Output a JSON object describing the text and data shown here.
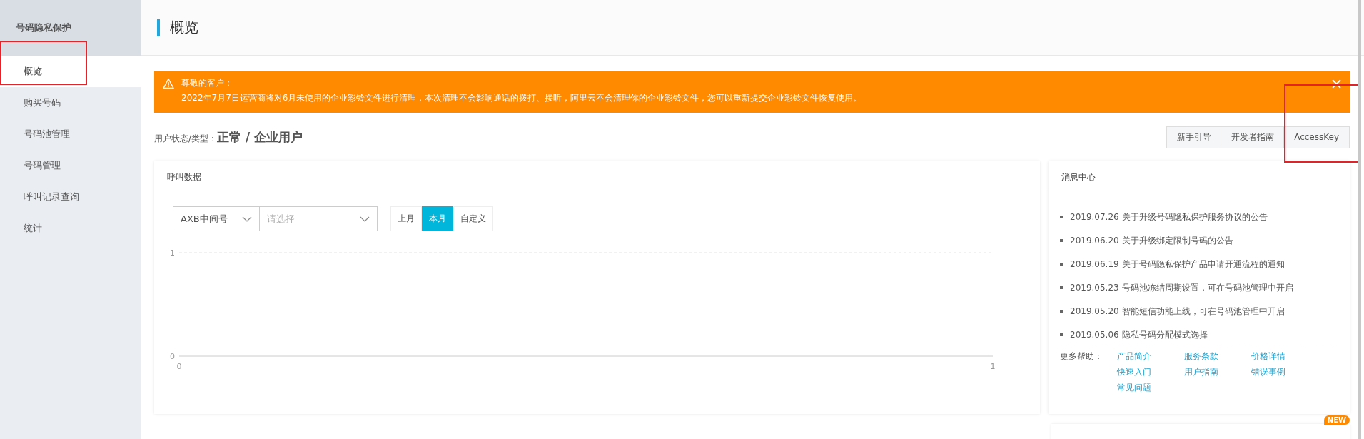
{
  "sidebar": {
    "title": "号码隐私保护",
    "items": [
      {
        "label": "概览",
        "selected": true,
        "highlighted": true
      },
      {
        "label": "购买号码",
        "selected": false,
        "highlighted": false
      },
      {
        "label": "号码池管理",
        "selected": false,
        "highlighted": false
      },
      {
        "label": "号码管理",
        "selected": false,
        "highlighted": false
      },
      {
        "label": "呼叫记录查询",
        "selected": false,
        "highlighted": false
      },
      {
        "label": "统计",
        "selected": false,
        "highlighted": false
      }
    ]
  },
  "page": {
    "title": "概览"
  },
  "alert": {
    "title": "尊敬的客户：",
    "message": "2022年7月7日运营商将对6月未使用的企业彩铃文件进行清理，本次清理不会影响通话的拨打、接听，阿里云不会清理你的企业彩铃文件，您可以重新提交企业彩铃文件恢复使用。"
  },
  "user_status": {
    "label": "用户状态/类型：",
    "value": "正常 / 企业用户"
  },
  "actions": [
    {
      "label": "新手引导",
      "highlighted": false
    },
    {
      "label": "开发者指南",
      "highlighted": false
    },
    {
      "label": "AccessKey",
      "highlighted": true
    }
  ],
  "call_data": {
    "title": "呼叫数据",
    "number_type": {
      "value": "AXB中间号"
    },
    "number_select": {
      "placeholder": "请选择"
    },
    "periods": [
      {
        "label": "上月",
        "selected": false
      },
      {
        "label": "本月",
        "selected": true
      },
      {
        "label": "自定义",
        "selected": false
      }
    ],
    "chart_data": {
      "type": "line",
      "xlim": [
        0,
        1
      ],
      "ylim": [
        0,
        1
      ],
      "xticks": [
        0,
        1
      ],
      "yticks": [
        0,
        1
      ]
    }
  },
  "messages": {
    "title": "消息中心",
    "items": [
      "2019.07.26 关于升级号码隐私保护服务协议的公告",
      "2019.06.20 关于升级绑定限制号码的公告",
      "2019.06.19 关于号码隐私保护产品申请开通流程的通知",
      "2019.05.23 号码池冻结周期设置，可在号码池管理中开启",
      "2019.05.20 智能短信功能上线，可在号码池管理中开启",
      "2019.05.06 隐私号码分配模式选择"
    ],
    "help_label": "更多帮助：",
    "help_links": [
      "产品简介",
      "服务条款",
      "价格详情",
      "快速入门",
      "用户指南",
      "错误事例",
      "常见问题"
    ]
  },
  "badge": "NEW"
}
